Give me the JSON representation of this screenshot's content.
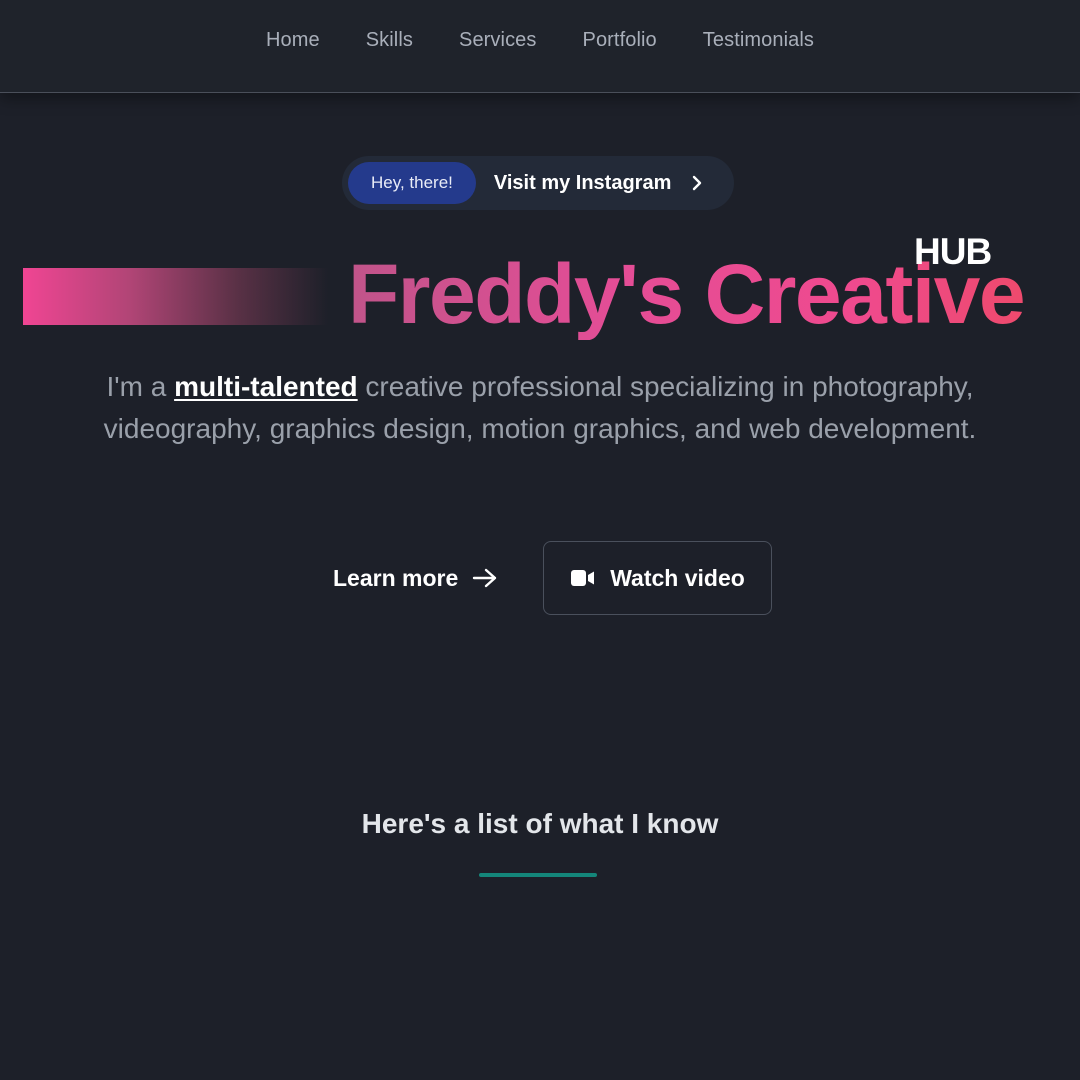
{
  "nav": {
    "items": [
      "Home",
      "Skills",
      "Services",
      "Portfolio",
      "Testimonials"
    ]
  },
  "announcement": {
    "badge": "Hey, there!",
    "link_text": "Visit my Instagram",
    "icon": "chevron-right-icon"
  },
  "hero": {
    "title": "Freddy's Creative",
    "badge": "HUB",
    "description_prefix": "I'm a ",
    "description_emphasis": "multi-talented",
    "description_suffix": " creative professional specializing in photography, videography, graphics design, motion graphics, and web development."
  },
  "cta": {
    "learn_more": "Learn more",
    "learn_more_icon": "arrow-right-icon",
    "watch_video": "Watch video",
    "watch_video_icon": "video-camera-icon"
  },
  "section": {
    "heading": "Here's a list of what I know"
  },
  "colors": {
    "background": "#1d2029",
    "accent_pink": "#ef4a8e",
    "badge_blue": "#243a8c",
    "rule_teal": "#14867a"
  }
}
